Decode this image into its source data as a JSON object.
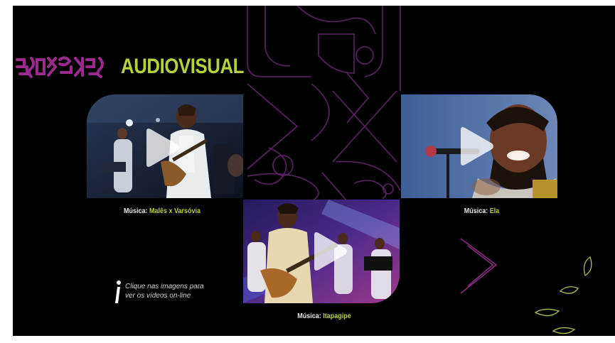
{
  "header": {
    "title": "AUDIOVISUAL"
  },
  "videos": [
    {
      "label_prefix": "Música: ",
      "song": "Malês x Varsóvia"
    },
    {
      "label_prefix": "Música: ",
      "song": "Ela"
    },
    {
      "label_prefix": "Música: ",
      "song": "Itapagipe"
    }
  ],
  "info": {
    "icon": "info-i-icon",
    "text_line1": "Clique nas imagens para",
    "text_line2": "ver os vídeos on-line"
  },
  "colors": {
    "background": "#000000",
    "accent_green": "#b4d23a",
    "accent_magenta": "#9c2a8e",
    "line_purple": "#6b2a6e"
  }
}
